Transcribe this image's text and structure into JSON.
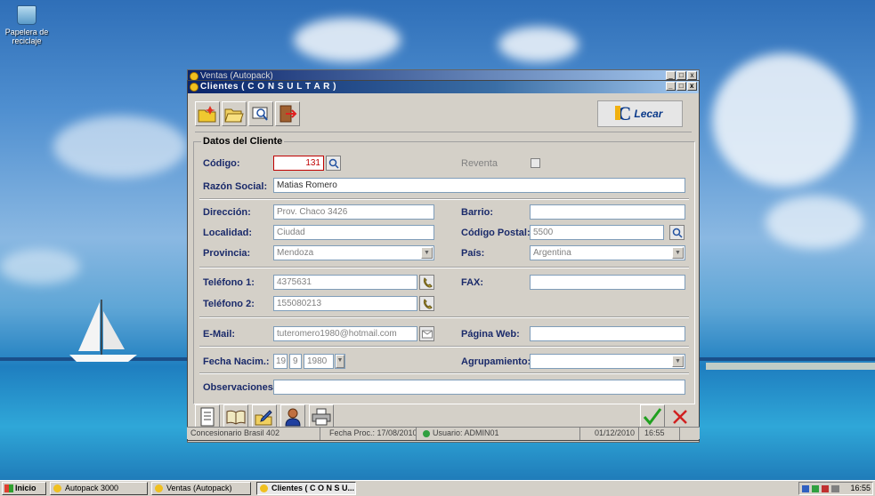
{
  "desktop": {
    "icon_label": "Papelera de reciclaje"
  },
  "back_window": {
    "title": "Ventas (Autopack)"
  },
  "main_window": {
    "title": "Clientes ( C O N S U L T A R )",
    "logo_text": "Lecar"
  },
  "form": {
    "group_title": "Datos del Cliente",
    "codigo": {
      "label": "Código:",
      "value": "131"
    },
    "reventa": {
      "label": "Reventa"
    },
    "razon_social": {
      "label": "Razón Social:",
      "value": "Matias Romero"
    },
    "direccion": {
      "label": "Dirección:",
      "value": "Prov. Chaco 3426"
    },
    "barrio": {
      "label": "Barrio:",
      "value": ""
    },
    "localidad": {
      "label": "Localidad:",
      "value": "Ciudad"
    },
    "codigo_postal": {
      "label": "Código Postal:",
      "value": "5500"
    },
    "provincia": {
      "label": "Provincia:",
      "value": "Mendoza"
    },
    "pais": {
      "label": "País:",
      "value": "Argentina"
    },
    "telefono1": {
      "label": "Teléfono 1:",
      "value": "4375631"
    },
    "fax": {
      "label": "FAX:",
      "value": ""
    },
    "telefono2": {
      "label": "Teléfono 2:",
      "value": "155080213"
    },
    "email": {
      "label": "E-Mail:",
      "value": "tuteromero1980@hotmail.com"
    },
    "pagina_web": {
      "label": "Página Web:",
      "value": ""
    },
    "fecha_nacim": {
      "label": "Fecha Nacim.:",
      "day": "19",
      "month": "9",
      "year": "1980"
    },
    "agrupamiento": {
      "label": "Agrupamiento:",
      "value": ""
    },
    "observaciones": {
      "label": "Observaciones:",
      "value": ""
    }
  },
  "statusbar": {
    "company": "Concesionario Brasil 402",
    "fecha_proc": "Fecha Proc.: 17/08/2010",
    "usuario": "Usuario: ADMIN01",
    "date": "01/12/2010",
    "time": "16:55"
  },
  "taskbar": {
    "start_label": "Inicio",
    "tasks": [
      "Autopack 3000",
      "Ventas (Autopack)",
      "Clientes ( C O N S U..."
    ],
    "clock": "16:55"
  },
  "colors": {
    "titlebar": "#0a246a",
    "accent_red": "#c00000",
    "label_blue": "#1a2a6a"
  }
}
